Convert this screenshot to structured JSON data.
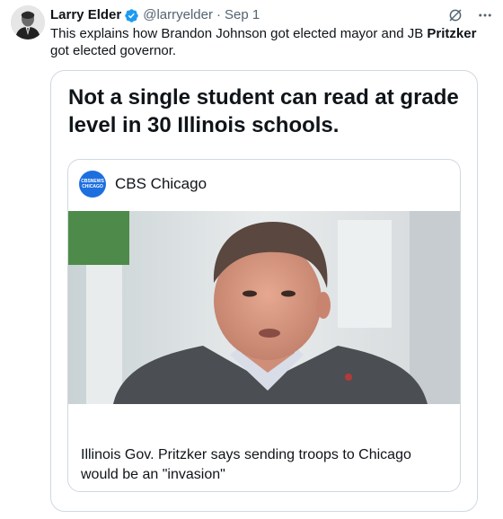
{
  "tweet": {
    "author_name": "Larry Elder",
    "handle": "@larryelder",
    "separator": "·",
    "date": "Sep 1",
    "text_before": "This explains how Brandon Johnson got elected mayor and JB ",
    "text_bold": "Pritzker",
    "text_after": " got elected governor.",
    "icons": [
      "verified-badge-icon",
      "grok-icon",
      "more-icon"
    ]
  },
  "quote": {
    "headline": "Not a single student can read at grade level in 30 Illinois schools.",
    "link_card": {
      "source_name": "CBS Chicago",
      "source_logo_line1": "CBSNEWS",
      "source_logo_line2": "CHICAGO",
      "caption": "Illinois Gov. Pritzker says sending troops to Chicago would be an \"invasion\""
    }
  },
  "colors": {
    "text_primary": "#0f1419",
    "text_secondary": "#536471",
    "verified_blue": "#1d9bf0",
    "border": "#cfd9de",
    "cbs_logo_blue": "#1d6fe0"
  }
}
